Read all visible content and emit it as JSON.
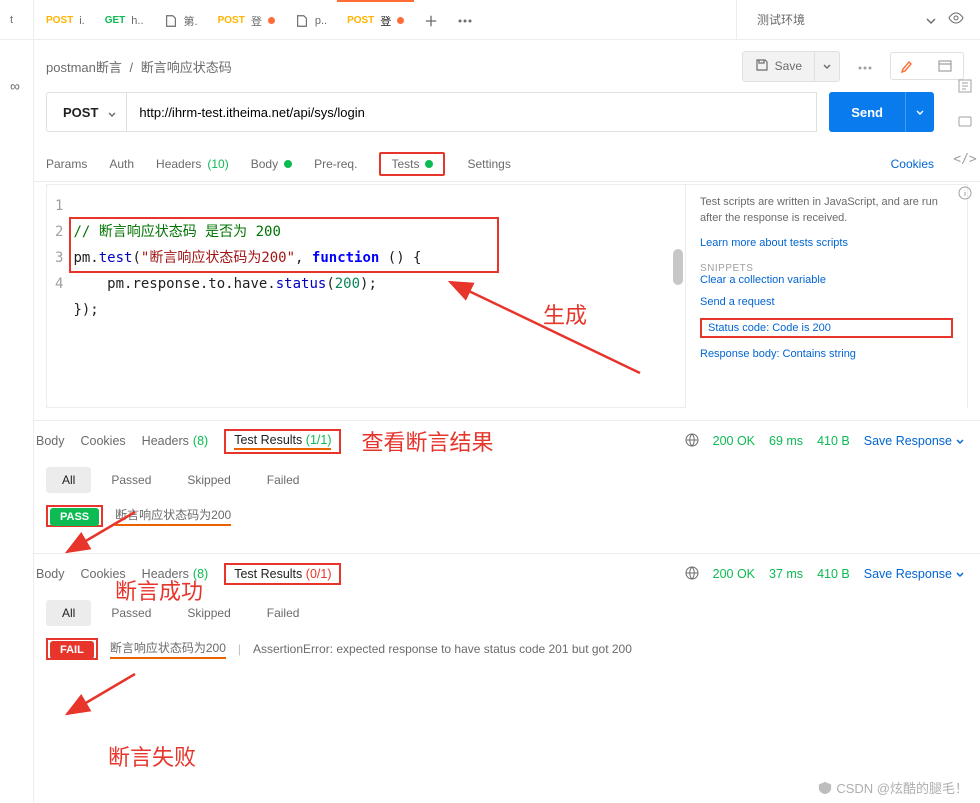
{
  "tabs": [
    {
      "method": "POST",
      "methodClass": "post",
      "label": "i.",
      "dot": false,
      "docIcon": false
    },
    {
      "method": "GET",
      "methodClass": "get",
      "label": "h..",
      "dot": false,
      "docIcon": false
    },
    {
      "method": "",
      "methodClass": "",
      "label": "第.",
      "dot": false,
      "docIcon": true
    },
    {
      "method": "POST",
      "methodClass": "post",
      "label": "登",
      "dot": true,
      "docIcon": false
    },
    {
      "method": "",
      "methodClass": "",
      "label": "p..",
      "dot": false,
      "docIcon": true
    },
    {
      "method": "POST",
      "methodClass": "post",
      "label": "登",
      "dot": true,
      "docIcon": false,
      "active": true
    }
  ],
  "environment": {
    "name": "测试环境"
  },
  "breadcrumb": {
    "collection": "postman断言",
    "name": "断言响应状态码"
  },
  "saveLabel": "Save",
  "request": {
    "method": "POST",
    "url": "http://ihrm-test.itheima.net/api/sys/login",
    "sendLabel": "Send"
  },
  "subtabs": {
    "params": "Params",
    "auth": "Auth",
    "headers": "Headers",
    "headersCount": "(10)",
    "body": "Body",
    "prereq": "Pre-req.",
    "tests": "Tests",
    "settings": "Settings",
    "cookies": "Cookies"
  },
  "code": {
    "lines": [
      "1",
      "2",
      "3",
      "4"
    ],
    "l1_c": "// 断言响应状态码 是否为 200",
    "l2_a": "pm.",
    "l2_b": "test",
    "l2_c": "(",
    "l2_d": "\"断言响应状态码为200\"",
    "l2_e": ", ",
    "l2_f": "function",
    "l2_g": " () {",
    "l3_a": "    pm.response.to.have.",
    "l3_b": "status",
    "l3_c": "(",
    "l3_d": "200",
    "l3_e": ");",
    "l4": "});"
  },
  "sidepane": {
    "txt": "Test scripts are written in JavaScript, and are run after the response is received.",
    "learn": "Learn more about tests scripts",
    "snipTitle": "SNIPPETS",
    "sn1": "Clear a collection variable",
    "sn2": "Send a request",
    "sn3": "Status code: Code is 200",
    "sn4": "Response body: Contains string"
  },
  "annotations": {
    "gen": "生成",
    "seeResult": "查看断言结果",
    "pass": "断言成功",
    "fail": "断言失败"
  },
  "respA": {
    "tabs": {
      "body": "Body",
      "cookies": "Cookies",
      "headers": "Headers",
      "headersCount": "(8)",
      "testResults": "Test Results",
      "trCount": "(1/1)"
    },
    "status": {
      "code": "200 OK",
      "time": "69 ms",
      "size": "410 B",
      "save": "Save Response"
    },
    "filters": {
      "all": "All",
      "passed": "Passed",
      "skipped": "Skipped",
      "failed": "Failed"
    },
    "badge": "PASS",
    "testName": "断言响应状态码为200"
  },
  "respB": {
    "tabs": {
      "body": "Body",
      "cookies": "Cookies",
      "headers": "Headers",
      "headersCount": "(8)",
      "testResults": "Test Results",
      "trCount": "(0/1)"
    },
    "status": {
      "code": "200 OK",
      "time": "37 ms",
      "size": "410 B",
      "save": "Save Response"
    },
    "filters": {
      "all": "All",
      "passed": "Passed",
      "skipped": "Skipped",
      "failed": "Failed"
    },
    "badge": "FAIL",
    "testName": "断言响应状态码为200",
    "err": "AssertionError: expected response to have status code 201 but got 200"
  },
  "watermark": "CSDN @炫酷的腿毛！"
}
